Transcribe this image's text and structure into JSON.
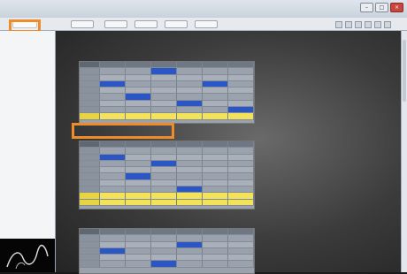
{
  "window": {
    "title": ""
  },
  "toolbar": {
    "buttons": [
      "",
      "",
      "",
      "",
      "",
      ""
    ]
  },
  "sidebar": {
    "items": [
      "",
      "",
      "",
      "",
      "",
      "",
      ""
    ]
  },
  "content": {
    "sections": [
      {
        "heading_1": "",
        "heading_2": ""
      },
      {
        "heading": ""
      },
      {
        "heading": ""
      }
    ]
  },
  "highlight_color": "#f08c28",
  "table_highlight_blue": "#2b57c6",
  "table_highlight_yellow": "#f3e35a"
}
